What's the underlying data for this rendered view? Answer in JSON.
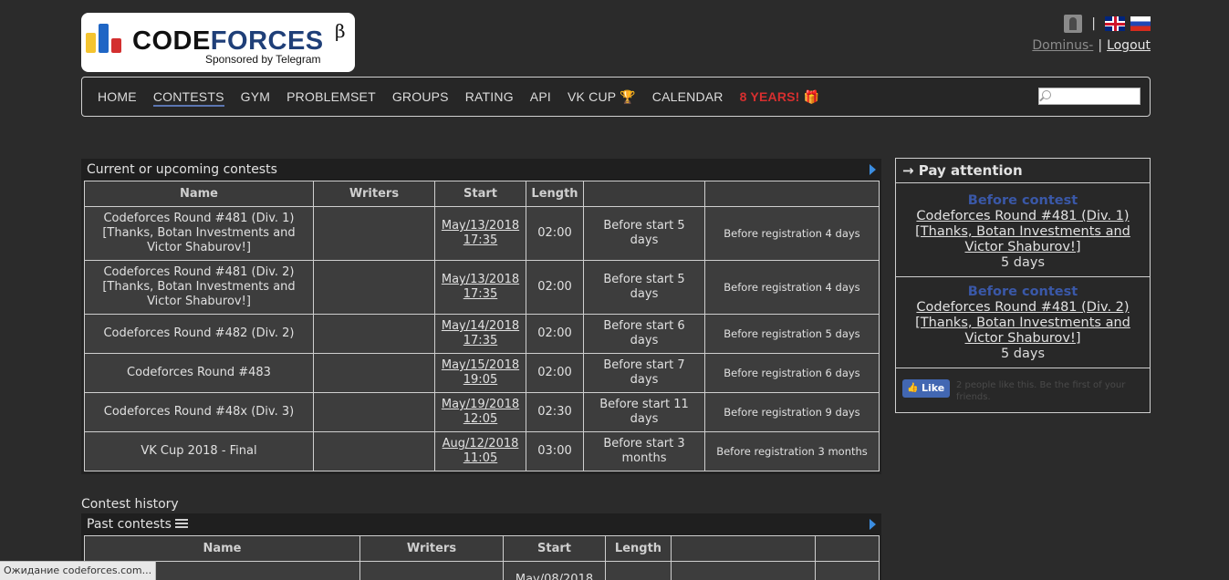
{
  "header": {
    "logo_text_part1": "CODE",
    "logo_text_part2": "FORCES",
    "logo_beta": "β",
    "sponsor": "Sponsored by Telegram",
    "username": "Dominus-",
    "logout_label": "Logout",
    "separator": "|"
  },
  "menu": {
    "items": [
      "HOME",
      "CONTESTS",
      "GYM",
      "PROBLEMSET",
      "GROUPS",
      "RATING",
      "API",
      "VK CUP 🏆",
      "CALENDAR",
      "8 YEARS! 🎁"
    ],
    "active": "CONTESTS",
    "search_placeholder": ""
  },
  "upcoming": {
    "caption": "Current or upcoming contests",
    "headers": [
      "Name",
      "Writers",
      "Start",
      "Length",
      "",
      ""
    ],
    "rows": [
      {
        "name": "Codeforces Round #481 (Div. 1) [Thanks, Botan Investments and Victor Shaburov!]",
        "writers": "",
        "start_date": "May/13/2018",
        "start_time": "17:35",
        "length": "02:00",
        "before_start": "Before start 5 days",
        "registration": "Before registration 4 days"
      },
      {
        "name": "Codeforces Round #481 (Div. 2) [Thanks, Botan Investments and Victor Shaburov!]",
        "writers": "",
        "start_date": "May/13/2018",
        "start_time": "17:35",
        "length": "02:00",
        "before_start": "Before start 5 days",
        "registration": "Before registration 4 days"
      },
      {
        "name": "Codeforces Round #482 (Div. 2)",
        "writers": "",
        "start_date": "May/14/2018",
        "start_time": "17:35",
        "length": "02:00",
        "before_start": "Before start 6 days",
        "registration": "Before registration 5 days"
      },
      {
        "name": "Codeforces Round #483",
        "writers": "",
        "start_date": "May/15/2018",
        "start_time": "19:05",
        "length": "02:00",
        "before_start": "Before start 7 days",
        "registration": "Before registration 6 days"
      },
      {
        "name": "Codeforces Round #48x (Div. 3)",
        "writers": "",
        "start_date": "May/19/2018",
        "start_time": "12:05",
        "length": "02:30",
        "before_start": "Before start 11 days",
        "registration": "Before registration 9 days"
      },
      {
        "name": "VK Cup 2018 - Final",
        "writers": "",
        "start_date": "Aug/12/2018",
        "start_time": "11:05",
        "length": "03:00",
        "before_start": "Before start 3 months",
        "registration": "Before registration 3 months"
      }
    ]
  },
  "history": {
    "title": "Contest history",
    "caption": "Past contests",
    "headers": [
      "Name",
      "Writers",
      "Start",
      "Length",
      "",
      ""
    ],
    "partial_row_start": "May/08/2018"
  },
  "sidebar": {
    "title": "→ Pay attention",
    "items": [
      {
        "label": "Before contest",
        "contest": "Codeforces Round #481 (Div. 1) [Thanks, Botan Investments and Victor Shaburov!]",
        "time": "5 days"
      },
      {
        "label": "Before contest",
        "contest": "Codeforces Round #481 (Div. 2) [Thanks, Botan Investments and Victor Shaburov!]",
        "time": "5 days"
      }
    ],
    "like_label": "Like",
    "like_text": "2 people like this. Be the first of your friends."
  },
  "status_bar": "Ожидание codeforces.com..."
}
